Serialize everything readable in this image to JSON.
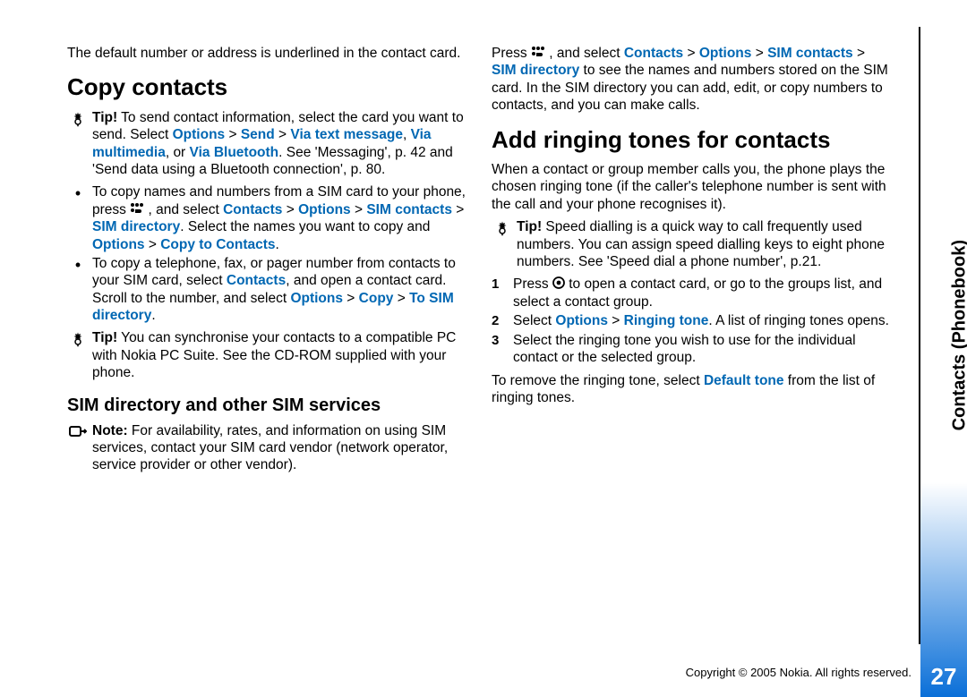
{
  "sideTab": "Contacts (Phonebook)",
  "pageNumber": "27",
  "copyright": "Copyright © 2005 Nokia. All rights reserved.",
  "left": {
    "intro": "The default number or address is underlined in the contact card.",
    "h1": "Copy contacts",
    "tip1_lead": "Tip!",
    "tip1_a": " To send contact information, select the card you want to send. Select ",
    "tip1_b": "Options",
    "tip1_c": " > ",
    "tip1_d": "Send",
    "tip1_e": " > ",
    "tip1_f": "Via text message",
    "tip1_g": ", ",
    "tip1_h": "Via multimedia",
    "tip1_i": ", or ",
    "tip1_j": "Via Bluetooth",
    "tip1_k": ". See 'Messaging', p. 42 and 'Send data using a Bluetooth connection', p. 80.",
    "li1_a": "To copy names and numbers from a SIM card to your phone, press ",
    "li1_b": " , and select ",
    "li1_c": "Contacts",
    "li1_d": " > ",
    "li1_e": "Options",
    "li1_f": " > ",
    "li1_g": "SIM contacts",
    "li1_h": " > ",
    "li1_i": "SIM directory",
    "li1_j": ". Select the names you want to copy and ",
    "li1_k": "Options",
    "li1_l": " > ",
    "li1_m": "Copy to Contacts",
    "li1_n": ".",
    "li2_a": "To copy a telephone, fax, or pager number from contacts to your SIM card, select ",
    "li2_b": "Contacts",
    "li2_c": ", and open a contact card. Scroll to the number, and select ",
    "li2_d": "Options",
    "li2_e": " > ",
    "li2_f": "Copy",
    "li2_g": " > ",
    "li2_h": "To SIM directory",
    "li2_i": ".",
    "tip2_lead": "Tip!",
    "tip2": " You can synchronise your contacts to a compatible PC with Nokia PC Suite. See the CD-ROM supplied with your phone.",
    "h2": "SIM directory and other SIM services",
    "note_lead": "Note:",
    "note": " For availability, rates, and information on using SIM services, contact your SIM card vendor (network operator, service provider or other vendor)."
  },
  "right": {
    "p1_a": "Press ",
    "p1_b": " , and select ",
    "p1_c": "Contacts",
    "p1_d": " > ",
    "p1_e": "Options",
    "p1_f": " >  ",
    "p1_g": "SIM contacts",
    "p1_h": " > ",
    "p1_i": "SIM directory",
    "p1_j": " to see the names and numbers stored on the SIM card. In the SIM directory you can add, edit, or copy numbers to contacts, and you can make calls.",
    "h1": "Add ringing tones for contacts",
    "p2": "When a contact or group member calls you, the phone plays the chosen ringing tone (if the caller's telephone number is sent with the call and your phone recognises it).",
    "tip_lead": "Tip!",
    "tip": " Speed dialling is a quick way to call frequently used numbers. You can assign speed dialling keys to eight phone numbers. See 'Speed dial a phone number', p.21.",
    "step1_a": "Press ",
    "step1_b": " to open a contact card, or go to the groups list, and select a contact group.",
    "step2_a": "Select ",
    "step2_b": "Options",
    "step2_c": " > ",
    "step2_d": "Ringing tone",
    "step2_e": ". A list of ringing tones opens.",
    "step3": "Select the ringing tone you wish to use for the individual contact or the selected group.",
    "p3_a": "To remove the ringing tone, select ",
    "p3_b": "Default tone",
    "p3_c": " from the list of ringing tones.",
    "num1": "1",
    "num2": "2",
    "num3": "3"
  }
}
